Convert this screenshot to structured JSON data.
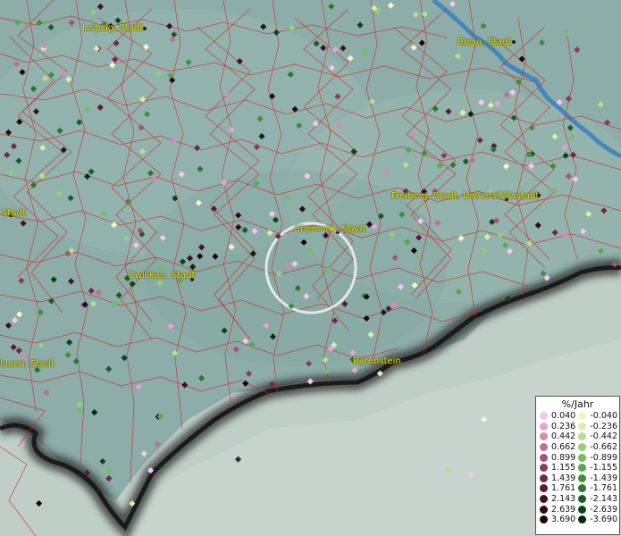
{
  "map": {
    "cities": [
      {
        "label": "Leipzig, Stadt"
      },
      {
        "label": "Riesa, Stadt"
      },
      {
        "label": "Freiberg, Stadt, Universitätsstadt"
      },
      {
        "label": "Chemnitz, Stadt"
      },
      {
        "label": "Zwickau, Stadt"
      },
      {
        "label": "Plauen, Stadt"
      },
      {
        "label": "Bärenstein"
      },
      {
        "label": "Stadt"
      }
    ]
  },
  "legend": {
    "title": "%/Jahr",
    "positive": [
      "0.040",
      "0.236",
      "0.442",
      "0.662",
      "0.899",
      "1.155",
      "1.439",
      "1.761",
      "2.143",
      "2.639",
      "3.690"
    ],
    "negative": [
      "-0.040",
      "-0.236",
      "-0.442",
      "-0.662",
      "-0.899",
      "-1.155",
      "-1.439",
      "-1.761",
      "-2.143",
      "-2.639",
      "-3.690"
    ],
    "positive_colors": [
      "#f7c6f0",
      "#e6a3d6",
      "#d68ab8",
      "#c06f98",
      "#a8527a",
      "#8d3a5e",
      "#722848",
      "#5a1a36",
      "#441026",
      "#300818",
      "#1c020c"
    ],
    "negative_colors": [
      "#f5f7c0",
      "#d9efa6",
      "#b7df8f",
      "#96cf78",
      "#76bd63",
      "#57a84f",
      "#3e903d",
      "#2a772d",
      "#1b5e20",
      "#104416",
      "#072b0d"
    ]
  }
}
